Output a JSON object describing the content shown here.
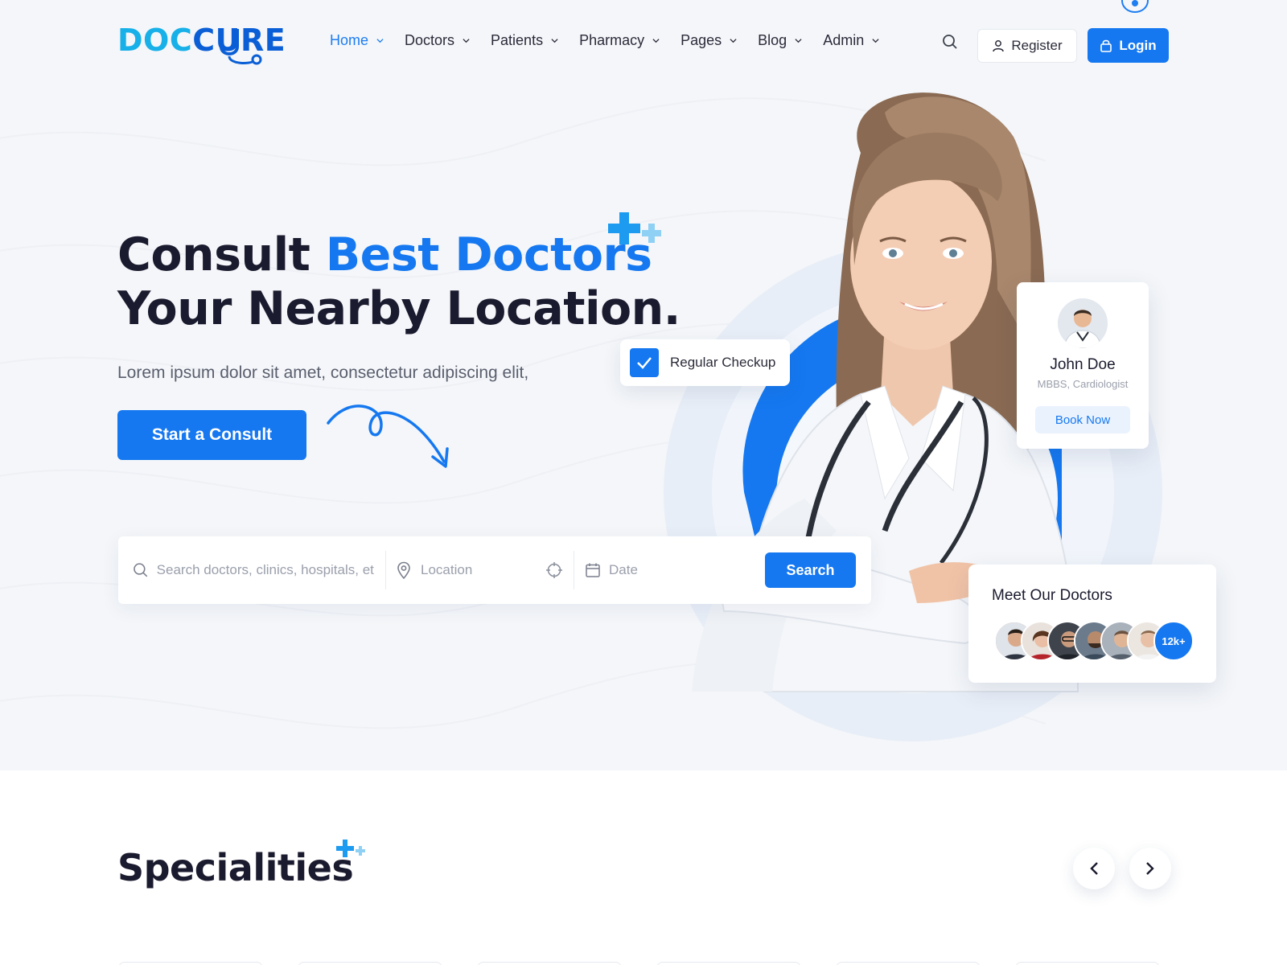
{
  "brand": {
    "logo_part1": "DOC",
    "logo_part2": "CURE",
    "primary_color": "#1578f0",
    "logo_color_light": "#17b0e8",
    "logo_color_dark": "#0b5fd6"
  },
  "nav": {
    "items": [
      {
        "label": "Home",
        "active": true
      },
      {
        "label": "Doctors",
        "active": false
      },
      {
        "label": "Patients",
        "active": false
      },
      {
        "label": "Pharmacy",
        "active": false
      },
      {
        "label": "Pages",
        "active": false
      },
      {
        "label": "Blog",
        "active": false
      },
      {
        "label": "Admin",
        "active": false
      }
    ],
    "register_label": "Register",
    "login_label": "Login"
  },
  "hero": {
    "title_part1": "Consult ",
    "title_accent": "Best Doctors",
    "title_line2": "Your Nearby Location.",
    "subtitle": "Lorem ipsum dolor sit amet, consectetur adipiscing elit,",
    "cta_label": "Start a Consult"
  },
  "search": {
    "query_placeholder": "Search doctors, clinics, hospitals, etc",
    "location_placeholder": "Location",
    "date_placeholder": "Date",
    "button_label": "Search"
  },
  "badges": {
    "checkup_label": "Regular Checkup"
  },
  "doctor_card": {
    "name": "John Doe",
    "role": "MBBS, Cardiologist",
    "button_label": "Book Now"
  },
  "meet_card": {
    "title": "Meet Our Doctors",
    "count_label": "12k+"
  },
  "specialities": {
    "title": "Specialities"
  }
}
